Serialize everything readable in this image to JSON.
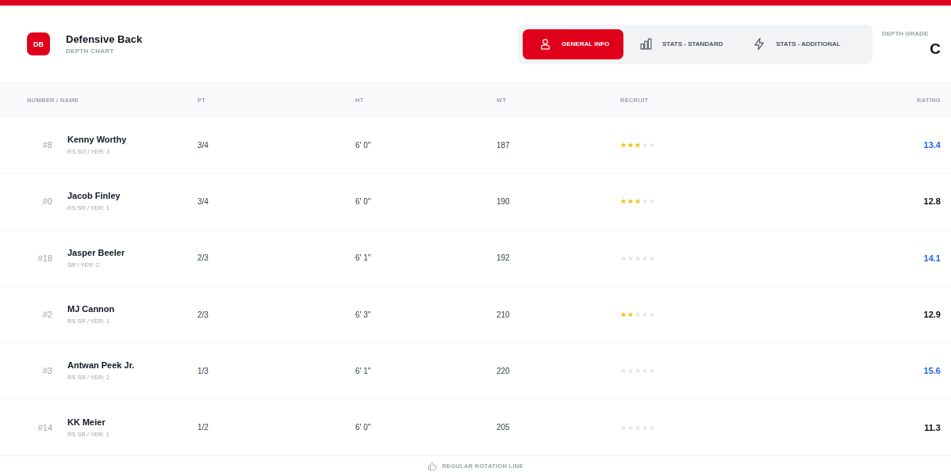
{
  "header": {
    "badge": "DB",
    "title": "Defensive Back",
    "subtitle": "DEPTH CHART"
  },
  "tabs": [
    {
      "label": "GENERAL INFO",
      "kind": "person",
      "selected": true
    },
    {
      "label": "STATS - STANDARD",
      "kind": "bars",
      "selected": false
    },
    {
      "label": "STATS - ADDITIONAL",
      "kind": "bolt",
      "selected": false
    }
  ],
  "depth_grade": {
    "label": "DEPTH GRADE",
    "value": "C"
  },
  "table": {
    "columns": [
      "NUMBER / NAME",
      "PT",
      "HT",
      "WT",
      "RECRUIT",
      "RATING"
    ],
    "rows": [
      {
        "number": "#8",
        "name": "Kenny Worthy",
        "detail": "RS SO / YER: 3",
        "pt": "3/4",
        "ht": "6' 0\"",
        "wt": "187",
        "stars": 3,
        "rating": "13.4",
        "highlight": true
      },
      {
        "number": "#0",
        "name": "Jacob Finley",
        "detail": "RS SR / YER: 1",
        "pt": "3/4",
        "ht": "6' 0\"",
        "wt": "190",
        "stars": 3,
        "rating": "12.8",
        "highlight": false
      },
      {
        "number": "#18",
        "name": "Jasper Beeler",
        "detail": "SR / YER: 2",
        "pt": "2/3",
        "ht": "6' 1\"",
        "wt": "192",
        "stars": 0,
        "rating": "14.1",
        "highlight": true
      },
      {
        "number": "#2",
        "name": "MJ Cannon",
        "detail": "RS SR / YER: 1",
        "pt": "2/3",
        "ht": "6' 3\"",
        "wt": "210",
        "stars": 2,
        "rating": "12.9",
        "highlight": false
      },
      {
        "number": "#3",
        "name": "Antwan Peek Jr.",
        "detail": "RS SR / YER: 2",
        "pt": "1/3",
        "ht": "6' 1\"",
        "wt": "220",
        "stars": 0,
        "rating": "15.6",
        "highlight": true
      },
      {
        "number": "#14",
        "name": "KK Meier",
        "detail": "RS SR / YER: 1",
        "pt": "1/2",
        "ht": "6' 0\"",
        "wt": "205",
        "stars": 0,
        "rating": "11.3",
        "highlight": false
      }
    ]
  },
  "footer": {
    "label": "REGULAR ROTATION LINE"
  }
}
